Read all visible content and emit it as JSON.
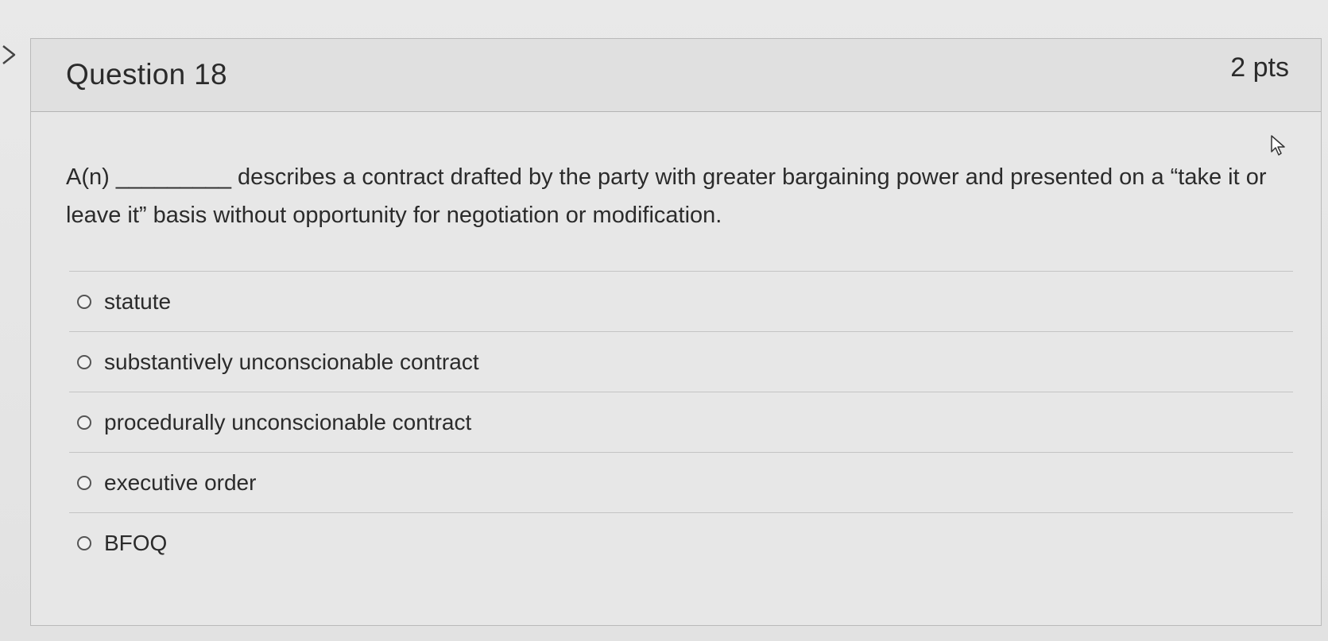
{
  "question": {
    "title": "Question 18",
    "points": "2 pts",
    "text": "A(n) _________ describes a contract drafted by the party with greater bargaining power and presented on a “take it or leave it” basis without opportunity for negotiation or modification."
  },
  "answers": [
    {
      "label": "statute"
    },
    {
      "label": "substantively unconscionable contract"
    },
    {
      "label": "procedurally unconscionable contract"
    },
    {
      "label": "executive order"
    },
    {
      "label": "BFOQ"
    }
  ],
  "icons": {
    "collapse": "chevron-right-icon",
    "cursor": "mouse-pointer-icon"
  }
}
